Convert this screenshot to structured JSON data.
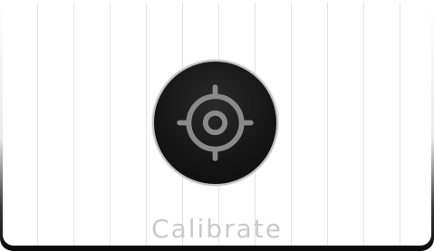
{
  "calibrate": {
    "label": "Calibrate",
    "icon": "crosshair-icon"
  }
}
